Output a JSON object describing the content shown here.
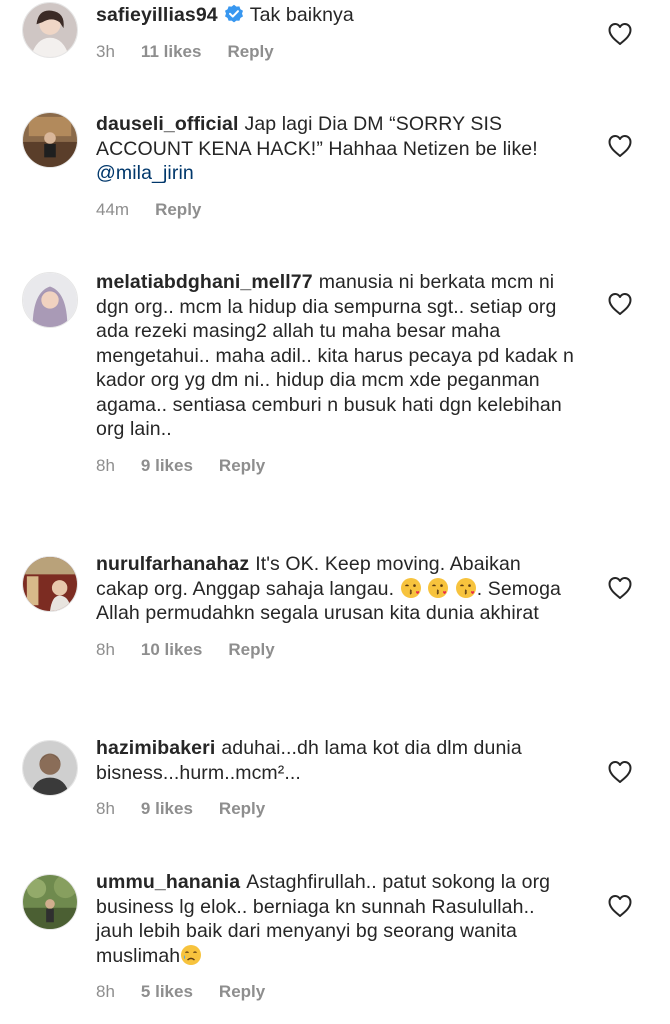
{
  "comments": [
    {
      "username": "safieyillias94",
      "verified": true,
      "parts": [
        "Tak baiknya"
      ],
      "time": "3h",
      "likes": "11 likes",
      "reply": "Reply"
    },
    {
      "username": "dauseli_official",
      "verified": false,
      "parts": [
        "Jap lagi Dia DM “SORRY SIS ACCOUNT KENA HACK!” Hahhaa Netizen be like! "
      ],
      "mention": "@mila_jirin",
      "time": "44m",
      "likes": "",
      "reply": "Reply"
    },
    {
      "username": "melatiabdghani_mell77",
      "verified": false,
      "parts": [
        "manusia ni berkata mcm ni dgn org.. mcm la hidup dia sempurna sgt.. setiap org ada rezeki masing2 allah tu maha besar maha mengetahui.. maha adil.. kita harus pecaya pd kadak n kador org yg dm ni.. hidup dia mcm xde peganman agama.. sentiasa cemburi n busuk hati dgn kelebihan org lain.."
      ],
      "time": "8h",
      "likes": "9 likes",
      "reply": "Reply"
    },
    {
      "username": "nurulfarhanahaz",
      "verified": false,
      "parts": [
        "It's OK. Keep moving. Abaikan cakap org. Anggap sahaja langau. ",
        ". Semoga Allah permudahkn segala urusan kita dunia akhirat"
      ],
      "emoji": "kissing-face-with-heart-emoji",
      "time": "8h",
      "likes": "10 likes",
      "reply": "Reply"
    },
    {
      "username": "hazimibakeri",
      "verified": false,
      "parts": [
        "aduhai...dh lama kot dia dlm dunia bisness...hurm..mcm²..."
      ],
      "time": "8h",
      "likes": "9 likes",
      "reply": "Reply"
    },
    {
      "username": "ummu_hanania",
      "verified": false,
      "parts": [
        "Astaghfirullah.. patut sokong la org business lg elok.. berniaga kn sunnah Rasulullah.. jauh lebih baik dari menyanyi bg seorang wanita muslimah"
      ],
      "emoji": "crying-face-emoji",
      "time": "8h",
      "likes": "5 likes",
      "reply": "Reply"
    }
  ],
  "icons": {
    "like": "heart-outline-icon",
    "verified": "verified-badge-icon"
  },
  "colors": {
    "text": "#262626",
    "meta": "#8e8e8e",
    "mention": "#00376b",
    "verified": "#3897f0"
  }
}
